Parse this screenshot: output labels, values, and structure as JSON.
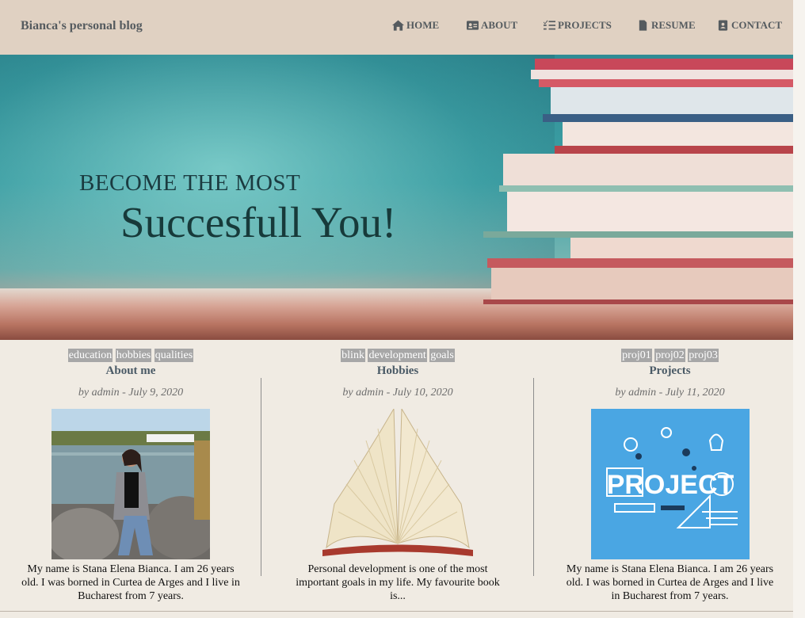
{
  "header": {
    "brand": "Bianca's personal blog",
    "nav": [
      {
        "label": "HOME",
        "icon": "home-icon"
      },
      {
        "label": "ABOUT",
        "icon": "id-card-icon"
      },
      {
        "label": "PROJECTS",
        "icon": "list-check-icon"
      },
      {
        "label": "RESUME",
        "icon": "file-icon"
      },
      {
        "label": "CONTACT",
        "icon": "contact-book-icon"
      }
    ]
  },
  "hero": {
    "line1": "BECOME THE MOST",
    "line2": "Succesfull You!"
  },
  "posts": [
    {
      "tags": [
        "education",
        "hobbies",
        "qualities"
      ],
      "title": "About me",
      "byline": "by admin - July 9, 2020",
      "image": "portrait-photo",
      "excerpt": "My name is Stana Elena Bianca. I am 26 years old. I was borned in Curtea de Arges and I live in Bucharest from 7 years."
    },
    {
      "tags": [
        "blink",
        "development",
        "goals"
      ],
      "title": "Hobbies",
      "byline": "by admin - July 10, 2020",
      "image": "open-book-image",
      "excerpt": "Personal development is one of the most important goals in my life. My favourite book is..."
    },
    {
      "tags": [
        "proj01",
        "proj02",
        "proj03"
      ],
      "title": "Projects",
      "byline": "by admin - July 11, 2020",
      "image": "project-illustration",
      "image_text": "PROJECT",
      "excerpt": "My name is Stana Elena Bianca. I am 26 years old. I was borned in Curtea de Arges and I live in Bucharest from 7 years."
    }
  ],
  "colors": {
    "header_bg": "#e0d1c2",
    "page_bg": "#f0ebe3",
    "tag_bg": "#a7a7a7",
    "nav_text": "#555b5f",
    "project_blue": "#4aa6e3"
  }
}
